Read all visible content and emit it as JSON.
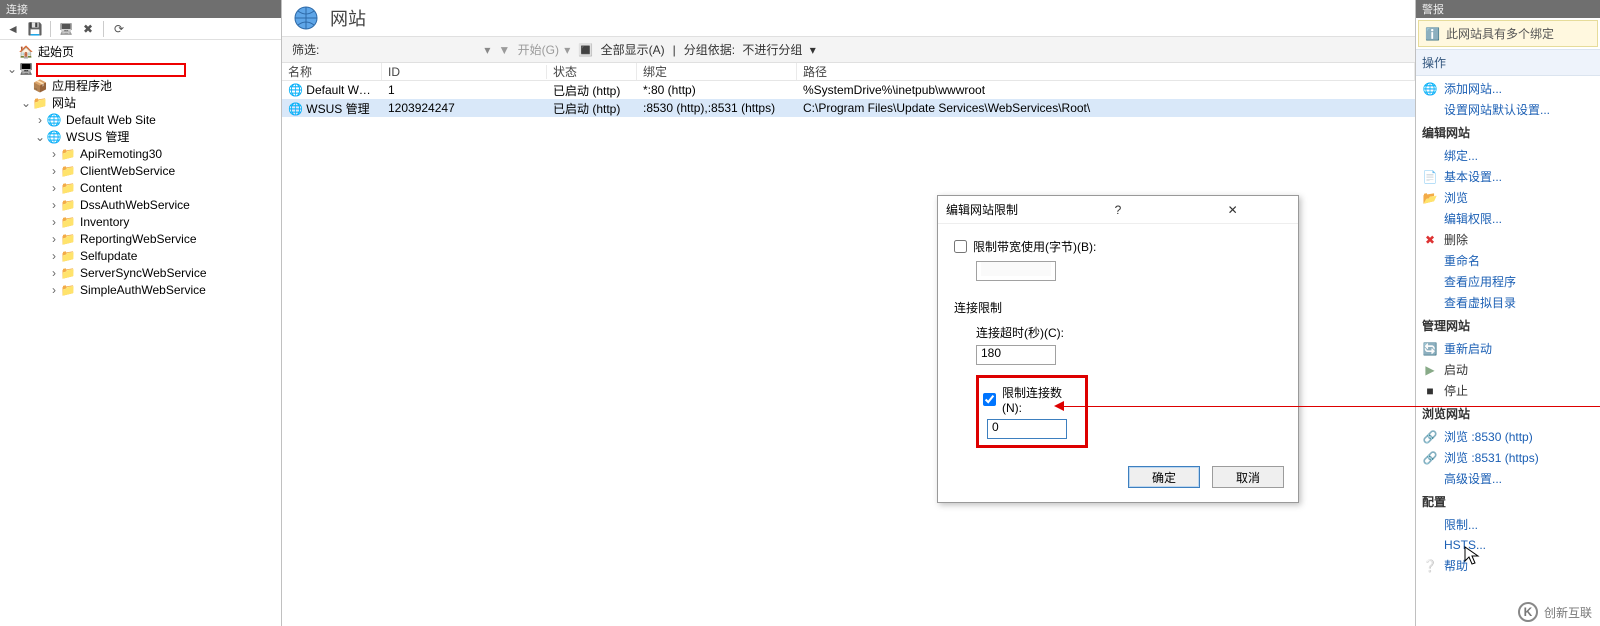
{
  "left": {
    "title": "连接",
    "tree": {
      "start": "起始页",
      "redacted": "",
      "apppools": "应用程序池",
      "sites": "网站",
      "defaultsite": "Default Web Site",
      "wsus": "WSUS 管理",
      "children": [
        "ApiRemoting30",
        "ClientWebService",
        "Content",
        "DssAuthWebService",
        "Inventory",
        "ReportingWebService",
        "Selfupdate",
        "ServerSyncWebService",
        "SimpleAuthWebService"
      ]
    }
  },
  "center": {
    "title": "网站",
    "filter": {
      "label": "筛选:",
      "start": "开始(G)",
      "showall": "全部显示(A)",
      "groupby": "分组依据:",
      "groupval": "不进行分组"
    },
    "cols": {
      "name": "名称",
      "id": "ID",
      "status": "状态",
      "bind": "绑定",
      "path": "路径"
    },
    "rows": [
      {
        "name": "Default Web S...",
        "id": "1",
        "status": "已启动 (http)",
        "bind": "*:80 (http)",
        "path": "%SystemDrive%\\inetpub\\wwwroot"
      },
      {
        "name": "WSUS 管理",
        "id": "1203924247",
        "status": "已启动 (http)",
        "bind": ":8530 (http),:8531 (https)",
        "path": "C:\\Program Files\\Update Services\\WebServices\\Root\\"
      }
    ]
  },
  "dialog": {
    "title": "编辑网站限制",
    "help": "?",
    "bandwidth_label": "限制带宽使用(字节)(B):",
    "bandwidth_value": "",
    "conn_section": "连接限制",
    "timeout_label": "连接超时(秒)(C):",
    "timeout_value": "180",
    "limitconn_label": "限制连接数(N):",
    "limitconn_value": "0",
    "ok": "确定",
    "cancel": "取消"
  },
  "right": {
    "top": "警报",
    "alert": "此网站具有多个绑定",
    "actions_title": "操作",
    "add_site": "添加网站...",
    "set_defaults": "设置网站默认设置...",
    "edit_site": "编辑网站",
    "bindings": "绑定...",
    "basic": "基本设置...",
    "browse": "浏览",
    "edit_perm": "编辑权限...",
    "delete": "删除",
    "rename": "重命名",
    "view_apps": "查看应用程序",
    "view_vdirs": "查看虚拟目录",
    "manage_site": "管理网站",
    "restart": "重新启动",
    "start": "启动",
    "stop": "停止",
    "browse_site": "浏览网站",
    "browse8530": "浏览 :8530 (http)",
    "browse8531": "浏览 :8531 (https)",
    "adv": "高级设置...",
    "config": "配置",
    "limits": "限制...",
    "hsts": "HSTS...",
    "help": "帮助"
  },
  "watermark": "创新互联"
}
